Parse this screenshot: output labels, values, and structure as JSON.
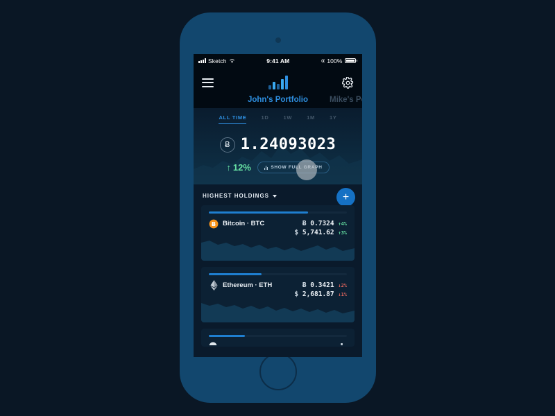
{
  "statusbar": {
    "carrier": "Sketch",
    "time": "9:41 AM",
    "battery": "100%"
  },
  "appbar": {
    "menu_icon": "hamburger-menu-icon",
    "logo_icon": "bar-chart-logo-icon",
    "settings_icon": "gear-icon"
  },
  "portfolios": [
    {
      "label": "John's Portfolio",
      "active": true
    },
    {
      "label": "Mike's Po",
      "active": false
    }
  ],
  "ranges": [
    {
      "label": "ALL TIME",
      "active": true
    },
    {
      "label": "1D",
      "active": false
    },
    {
      "label": "1W",
      "active": false
    },
    {
      "label": "1M",
      "active": false
    },
    {
      "label": "1Y",
      "active": false
    }
  ],
  "hero": {
    "currency_symbol": "Ƀ",
    "balance": "1.24093023",
    "change_arrow": "↑",
    "change": "12%",
    "graph_button": "SHOW FULL GRAPH",
    "graph_icon": "bar-chart-icon"
  },
  "holdings": {
    "title": "HIGHEST HOLDINGS",
    "sort_caret": "chevron-down-icon",
    "add_button": "+",
    "items": [
      {
        "name": "Bitcoin",
        "ticker": "BTC",
        "separator": "·",
        "icon": "bitcoin-icon",
        "icon_color": "#f7931a",
        "bar_percent": 72,
        "crypto_symbol": "Ƀ",
        "crypto_amount": "0.7324",
        "crypto_arrow": "↑",
        "crypto_change": "4%",
        "crypto_dir": "up",
        "fiat_symbol": "$",
        "fiat_amount": "5,741.62",
        "fiat_arrow": "↑",
        "fiat_change": "3%",
        "fiat_dir": "up"
      },
      {
        "name": "Ethereum",
        "ticker": "ETH",
        "separator": "·",
        "icon": "ethereum-icon",
        "icon_color": "#b3bcc6",
        "bar_percent": 38,
        "crypto_symbol": "Ƀ",
        "crypto_amount": "0.3421",
        "crypto_arrow": "↓",
        "crypto_change": "2%",
        "crypto_dir": "down",
        "fiat_symbol": "$",
        "fiat_amount": "2,681.87",
        "fiat_arrow": "↓",
        "fiat_change": "1%",
        "fiat_dir": "down"
      }
    ]
  },
  "colors": {
    "accent": "#2e8fe0",
    "positive": "#66e0a3",
    "negative": "#e8685f",
    "bitcoin": "#f7931a",
    "screen_bg": "#0a1a2b",
    "phone_body": "#12476e"
  }
}
